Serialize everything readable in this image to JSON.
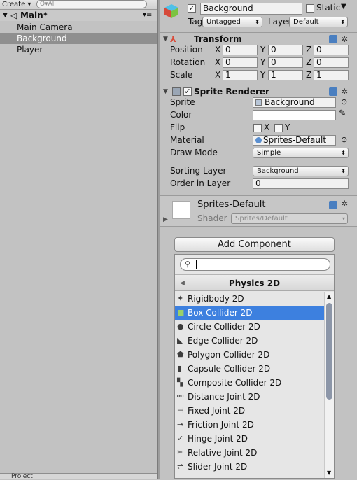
{
  "hierarchy": {
    "create_label": "Create ▾",
    "search_placeholder": "Q▾All",
    "scene_name": "Main*",
    "items": [
      {
        "label": "Main Camera",
        "selected": false
      },
      {
        "label": "Background",
        "selected": true
      },
      {
        "label": "Player",
        "selected": false
      }
    ],
    "bottom_tab": "Project"
  },
  "inspector": {
    "object_name": "Background",
    "static_label": "Static",
    "tag_label": "Tag",
    "tag_value": "Untagged",
    "layer_label": "Layer",
    "layer_value": "Default",
    "transform": {
      "title": "Transform",
      "rows": [
        {
          "label": "Position",
          "x": "0",
          "y": "0",
          "z": "0"
        },
        {
          "label": "Rotation",
          "x": "0",
          "y": "0",
          "z": "0"
        },
        {
          "label": "Scale",
          "x": "1",
          "y": "1",
          "z": "1"
        }
      ]
    },
    "sprite_renderer": {
      "title": "Sprite Renderer",
      "sprite_label": "Sprite",
      "sprite_value": "Background",
      "color_label": "Color",
      "flip_label": "Flip",
      "flip_x": "X",
      "flip_y": "Y",
      "material_label": "Material",
      "material_value": "Sprites-Default",
      "draw_mode_label": "Draw Mode",
      "draw_mode_value": "Simple",
      "sorting_layer_label": "Sorting Layer",
      "sorting_layer_value": "Background",
      "order_label": "Order in Layer",
      "order_value": "0"
    },
    "material_preview": {
      "name": "Sprites-Default",
      "shader_label": "Shader",
      "shader_value": "Sprites/Default"
    },
    "add_component_label": "Add Component",
    "picker": {
      "category": "Physics 2D",
      "items": [
        {
          "label": "Rigidbody 2D",
          "icon": "rigidbody-icon",
          "selected": false
        },
        {
          "label": "Box Collider 2D",
          "icon": "box-collider-icon",
          "selected": true
        },
        {
          "label": "Circle Collider 2D",
          "icon": "circle-collider-icon",
          "selected": false
        },
        {
          "label": "Edge Collider 2D",
          "icon": "edge-collider-icon",
          "selected": false
        },
        {
          "label": "Polygon Collider 2D",
          "icon": "polygon-collider-icon",
          "selected": false
        },
        {
          "label": "Capsule Collider 2D",
          "icon": "capsule-collider-icon",
          "selected": false
        },
        {
          "label": "Composite Collider 2D",
          "icon": "composite-collider-icon",
          "selected": false
        },
        {
          "label": "Distance Joint 2D",
          "icon": "distance-joint-icon",
          "selected": false
        },
        {
          "label": "Fixed Joint 2D",
          "icon": "fixed-joint-icon",
          "selected": false
        },
        {
          "label": "Friction Joint 2D",
          "icon": "friction-joint-icon",
          "selected": false
        },
        {
          "label": "Hinge Joint 2D",
          "icon": "hinge-joint-icon",
          "selected": false
        },
        {
          "label": "Relative Joint 2D",
          "icon": "relative-joint-icon",
          "selected": false
        },
        {
          "label": "Slider Joint 2D",
          "icon": "slider-joint-icon",
          "selected": false
        }
      ]
    }
  },
  "colors": {
    "selection_blue": "#3d80df",
    "panel_bg": "#c2c2c2",
    "icon_green": "#6fbf3a"
  }
}
